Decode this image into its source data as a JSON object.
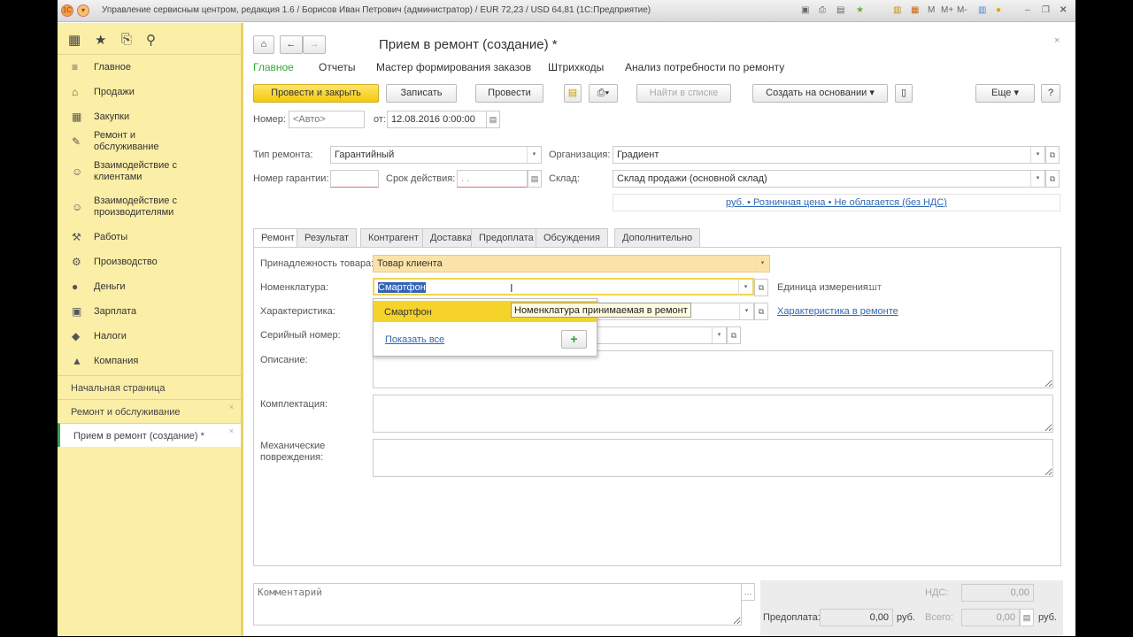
{
  "window": {
    "title": "Управление сервисным центром, редакция 1.6 / Борисов Иван Петрович (администратор) / EUR 72,23 / USD 64,81  (1С:Предприятие)",
    "tools": [
      "M",
      "M+",
      "M-"
    ]
  },
  "sidebar": {
    "items": [
      {
        "label": "Главное",
        "icon": "menu-icon"
      },
      {
        "label": "Продажи",
        "icon": "basket-icon"
      },
      {
        "label": "Закупки",
        "icon": "cart-icon"
      },
      {
        "label": "Ремонт и обслуживание",
        "icon": "wrench-icon"
      },
      {
        "label": "Взаимодействие с клиентами",
        "icon": "people-icon"
      },
      {
        "label": "Взаимодействие с производителями",
        "icon": "people-icon"
      },
      {
        "label": "Работы",
        "icon": "hammer-icon"
      },
      {
        "label": "Производство",
        "icon": "factory-icon"
      },
      {
        "label": "Деньги",
        "icon": "coin-icon"
      },
      {
        "label": "Зарплата",
        "icon": "wallet-icon"
      },
      {
        "label": "Налоги",
        "icon": "tax-icon"
      },
      {
        "label": "Компания",
        "icon": "building-icon"
      }
    ],
    "open_windows": [
      "Начальная страница",
      "Ремонт и обслуживание",
      "Прием в ремонт (создание) *"
    ]
  },
  "form": {
    "title": "Прием в ремонт (создание) *",
    "nav": [
      "Главное",
      "Отчеты",
      "Мастер формирования заказов",
      "Штрихкоды",
      "Анализ потребности по ремонту"
    ],
    "toolbar": {
      "post_close": "Провести и закрыть",
      "save": "Записать",
      "post": "Провести",
      "find": "Найти в списке",
      "create_based": "Создать на основании",
      "more": "Еще",
      "help": "?"
    },
    "number_label": "Номер:",
    "number_placeholder": "<Авто>",
    "date_label": "от:",
    "date": "12.08.2016  0:00:00",
    "repair_type_label": "Тип ремонта:",
    "repair_type": "Гарантийный",
    "org_label": "Организация:",
    "org": "Градиент",
    "warranty_label": "Номер гарантии:",
    "validity_label": "Срок действия:",
    "validity": " .  .",
    "warehouse_label": "Склад:",
    "warehouse": "Склад продажи (основной склад)",
    "price_link": "руб. • Розничная цена • Не облагается (без НДС)",
    "tabs": [
      "Ремонт",
      "Результат",
      "Контрагент",
      "Доставка",
      "Предоплата",
      "Обсуждения",
      "Дополнительно"
    ],
    "ownership_label": "Принадлежность товара:",
    "ownership": "Товар клиента",
    "item_label": "Номенклатура:",
    "item": "Смартфон",
    "unit_label": "Единица измерения:",
    "unit": "шт",
    "char_label": "Характеристика:",
    "char_link": "Характеристика в ремонте",
    "serial_label": "Серийный номер:",
    "desc_label": "Описание:",
    "kit_label": "Комплектация:",
    "damage_label": "Механические повреждения:",
    "dropdown": {
      "option": "Смартфон",
      "tooltip": "Номенклатура принимаемая в ремонт",
      "show_all": "Показать все"
    },
    "comment_placeholder": "Комментарий",
    "totals": {
      "vat_label": "НДС:",
      "vat": "0,00",
      "prepay_label": "Предоплата:",
      "prepay": "0,00",
      "total_label": "Всего:",
      "total": "0,00",
      "currency": "руб."
    }
  }
}
